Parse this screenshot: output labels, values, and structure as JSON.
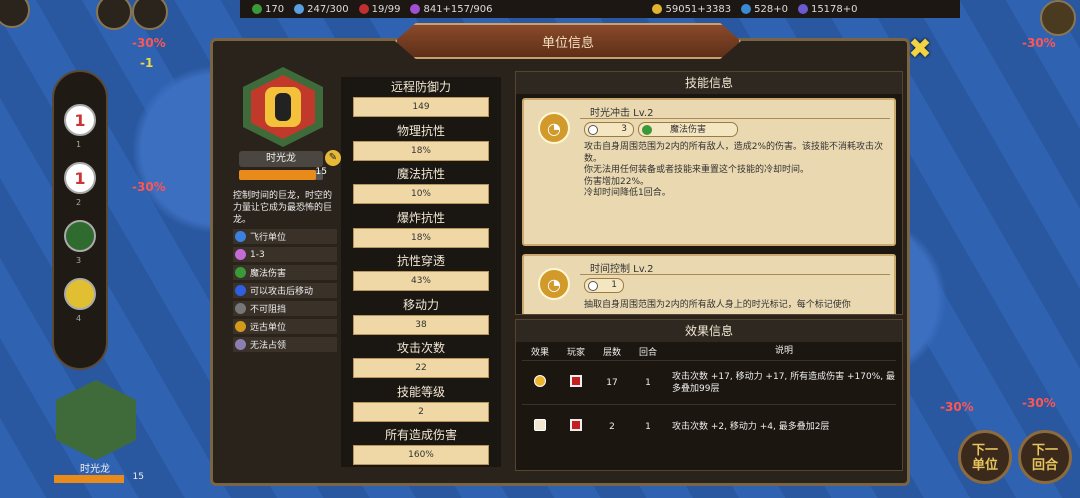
{
  "topbar": {
    "r1": "170",
    "r2": "247/300",
    "r3": "19/99",
    "r4": "841+157/906",
    "r5": "59051+3383",
    "r6": "528+0",
    "r7": "15178+0"
  },
  "dialog": {
    "title": "单位信息",
    "close_icon": "close-x-icon"
  },
  "unit": {
    "name": "时光龙",
    "level": "15",
    "xp_fraction": 0.92,
    "description": "控制时间的巨龙，时空的力量让它成为最恐怖的巨龙。",
    "traits": [
      {
        "icon": "flying-icon",
        "label": "飞行单位",
        "color": "#3b82e0"
      },
      {
        "icon": "range-icon",
        "label": "1-3",
        "color": "#c56bd6"
      },
      {
        "icon": "magic-damage-icon",
        "label": "魔法伤害",
        "color": "#3a9a3a"
      },
      {
        "icon": "move-after-attack-icon",
        "label": "可以攻击后移动",
        "color": "#2f5fe0"
      },
      {
        "icon": "unstoppable-icon",
        "label": "不可阻挡",
        "color": "#777"
      },
      {
        "icon": "ranged-unit-icon",
        "label": "远古单位",
        "color": "#d39a1c"
      },
      {
        "icon": "no-capture-icon",
        "label": "无法占领",
        "color": "#8a7fb0"
      }
    ]
  },
  "stats": [
    {
      "label": "远程防御力",
      "value": "149"
    },
    {
      "label": "物理抗性",
      "value": "18%"
    },
    {
      "label": "魔法抗性",
      "value": "10%"
    },
    {
      "label": "爆炸抗性",
      "value": "18%"
    },
    {
      "label": "抗性穿透",
      "value": "43%"
    },
    {
      "label": "移动力",
      "value": "38"
    },
    {
      "label": "攻击次数",
      "value": "22"
    },
    {
      "label": "技能等级",
      "value": "2"
    },
    {
      "label": "所有造成伤害",
      "value": "160%"
    }
  ],
  "skills": {
    "header": "技能信息",
    "s1": {
      "name": "时光冲击 Lv.2",
      "cooldown": "3",
      "damage_type": "魔法伤害",
      "text": "攻击自身周围范围为2内的所有敌人，造成2%的伤害。该技能不消耗攻击次数。\n你无法用任何装备或者技能来重置这个技能的冷却时间。\n伤害增加22%。\n冷却时间降低1回合。"
    },
    "s2": {
      "name": "时间控制 Lv.2",
      "cooldown": "1",
      "text": "抽取自身周围范围为2内的所有敌人身上的时光标记，每个标记使你"
    }
  },
  "effects": {
    "header": "效果信息",
    "cols": [
      "效果",
      "玩家",
      "层数",
      "回合",
      "说明"
    ],
    "rows": [
      {
        "stacks": "17",
        "turns": "1",
        "desc": "攻击次数 +17, 移动力 +17, 所有造成伤害 +170%, 最多叠加99层"
      },
      {
        "stacks": "2",
        "turns": "1",
        "desc": "攻击次数 +2, 移动力 +4, 最多叠加2层"
      }
    ]
  },
  "sidebar": {
    "buttons": [
      "1",
      "1",
      "",
      "",
      ""
    ],
    "nums": [
      "1",
      "2",
      "3",
      "4"
    ]
  },
  "bottom": {
    "name": "时光龙",
    "level": "15"
  },
  "buttons": {
    "next_unit": "下一\n单位",
    "next_turn": "下一\n回合"
  },
  "map": {
    "m1": "-30%",
    "m2": "-1"
  }
}
